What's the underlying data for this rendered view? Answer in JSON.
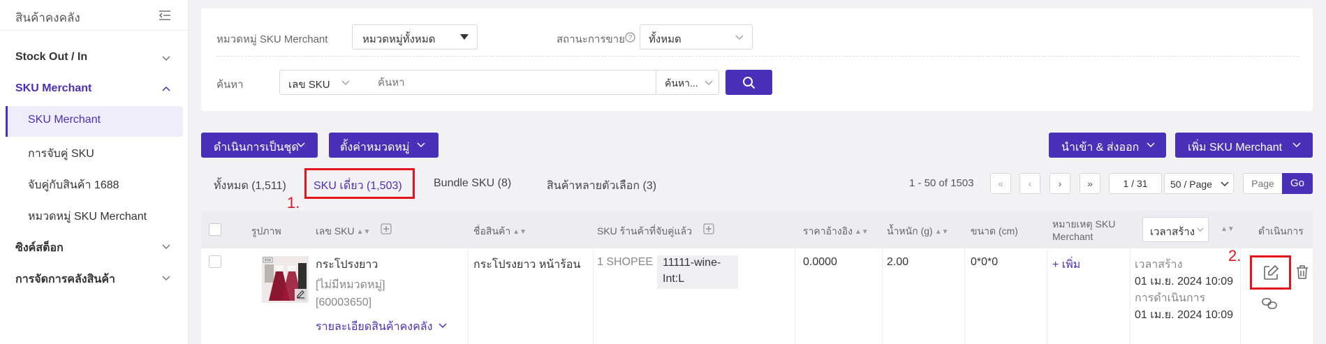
{
  "sidebar": {
    "title": "สินค้าคงคลัง",
    "groups": [
      {
        "label": "Stock Out / In"
      },
      {
        "label": "SKU Merchant"
      },
      {
        "label": "ซิงค์สต็อก"
      },
      {
        "label": "การจัดการคลังสินค้า"
      }
    ],
    "items": [
      {
        "label": "SKU Merchant"
      },
      {
        "label": "การจับคู่ SKU"
      },
      {
        "label": "จับคู่กับสินค้า 1688"
      },
      {
        "label": "หมวดหมู่ SKU Merchant"
      }
    ]
  },
  "filters": {
    "category_label": "หมวดหมู่ SKU Merchant",
    "category_value": "หมวดหมู่ทั้งหมด",
    "status_label": "สถานะการขาย",
    "status_value": "ทั้งหมด",
    "search_label": "ค้นหา",
    "search_field": "เลข SKU",
    "search_placeholder": "ค้นหา",
    "search_mode": "ค้นหา..."
  },
  "toolbar": {
    "bulk_action": "ดำเนินการเป็นชุด",
    "set_category": "ตั้งค่าหมวดหมู่",
    "import_export": "นำเข้า & ส่งออก",
    "add_sku": "เพิ่ม SKU Merchant"
  },
  "tabs": [
    {
      "label": "ทั้งหมด (1,511)"
    },
    {
      "label": "SKU เดี่ยว (1,503)"
    },
    {
      "label": "Bundle SKU (8)"
    },
    {
      "label": "สินค้าหลายตัวเลือก (3)"
    }
  ],
  "annotations": {
    "one": "1.",
    "two": "2."
  },
  "pagination": {
    "range": "1 - 50 of 1503",
    "page": "1 / 31",
    "per_page": "50 / Page",
    "page_placeholder": "Page",
    "go": "Go"
  },
  "table": {
    "headers": {
      "image": "รูปภาพ",
      "sku": "เลข SKU",
      "name": "ชื่อสินค้า",
      "matched": "SKU ร้านค้าที่จับคู่แล้ว",
      "price": "ราคาอ้างอิง",
      "weight": "น้ำหนัก (g)",
      "size": "ขนาด (cm)",
      "note_line1": "หมายเหตุ SKU",
      "note_line2": "Merchant",
      "time_select": "เวลาสร้าง",
      "actions": "ดำเนินการ"
    },
    "row": {
      "sku_name": "กระโปรงยาว",
      "category": "[ไม่มีหมวดหมู่]",
      "sku_id": "[60003650]",
      "detail_link": "รายละเอียดสินค้าคงคลัง",
      "product_name": "กระโปรงยาว หน้าร้อน",
      "shop": "1 SHOPEE",
      "matched_sku_line1": "11111-wine-",
      "matched_sku_line2": "Int:L",
      "price": "0.0000",
      "weight": "2.00",
      "size": "0*0*0",
      "note_add": "+ เพิ่ม",
      "created_label": "เวลาสร้าง",
      "created_time": "01 เม.ย. 2024 10:09",
      "updated_label": "การดำเนินการ",
      "updated_time": "01 เม.ย. 2024 10:09"
    }
  }
}
